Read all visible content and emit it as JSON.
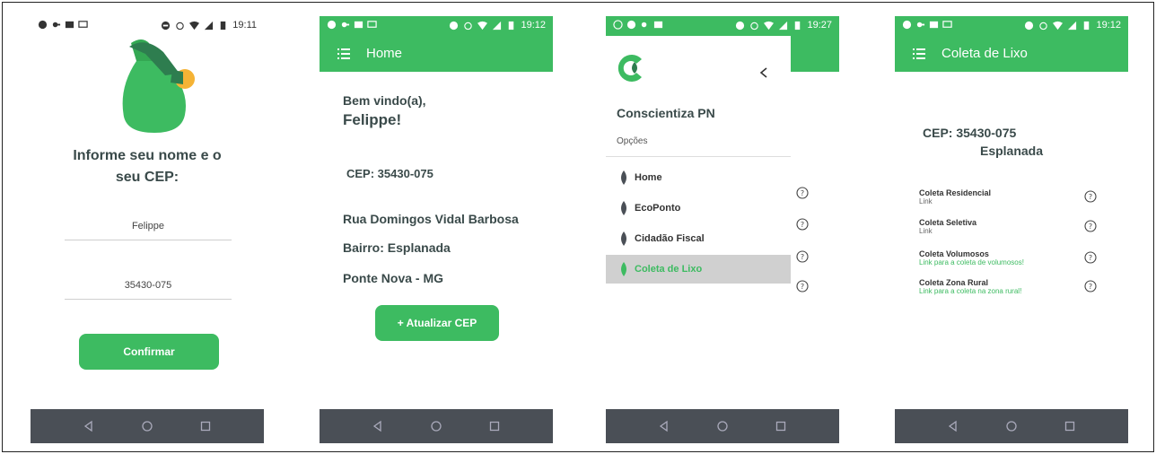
{
  "screen1": {
    "status": {
      "time": "19:11"
    },
    "prompt_line1": "Informe seu nome e o",
    "prompt_line2": "seu CEP:",
    "name_value": "Felippe",
    "cep_value": "35430-075",
    "confirm_label": "Confirmar"
  },
  "screen2": {
    "status": {
      "time": "19:12"
    },
    "title": "Home",
    "welcome_line1": "Bem vindo(a),",
    "welcome_line2": "Felippe!",
    "cep": "CEP: 35430-075",
    "street": "Rua Domingos Vidal Barbosa",
    "neighborhood": "Bairro: Esplanada",
    "city": "Ponte Nova - MG",
    "update_label": "+ Atualizar CEP"
  },
  "screen3": {
    "status": {
      "time": "19:27"
    },
    "app_name": "Conscientiza PN",
    "options_label": "Opções",
    "menu_items": [
      "Home",
      "EcoPonto",
      "Cidadão Fiscal",
      "Coleta de Lixo"
    ]
  },
  "screen4": {
    "status": {
      "time": "19:12"
    },
    "title": "Coleta de Lixo",
    "cep": "CEP: 35430-075",
    "neighborhood": "Esplanada",
    "items": [
      {
        "title": "Coleta Residencial",
        "link": "Link"
      },
      {
        "title": "Coleta Seletiva",
        "link": "Link"
      },
      {
        "title": "Coleta Volumosos",
        "link": "Link para a coleta de volumosos!"
      },
      {
        "title": "Coleta Zona Rural",
        "link": "Link para a coleta na zona rural!"
      }
    ]
  },
  "colors": {
    "accent": "#3dbb61",
    "navbar": "#4a4f56",
    "text": "#3a4a4a",
    "selected": "#d0d0d0"
  }
}
